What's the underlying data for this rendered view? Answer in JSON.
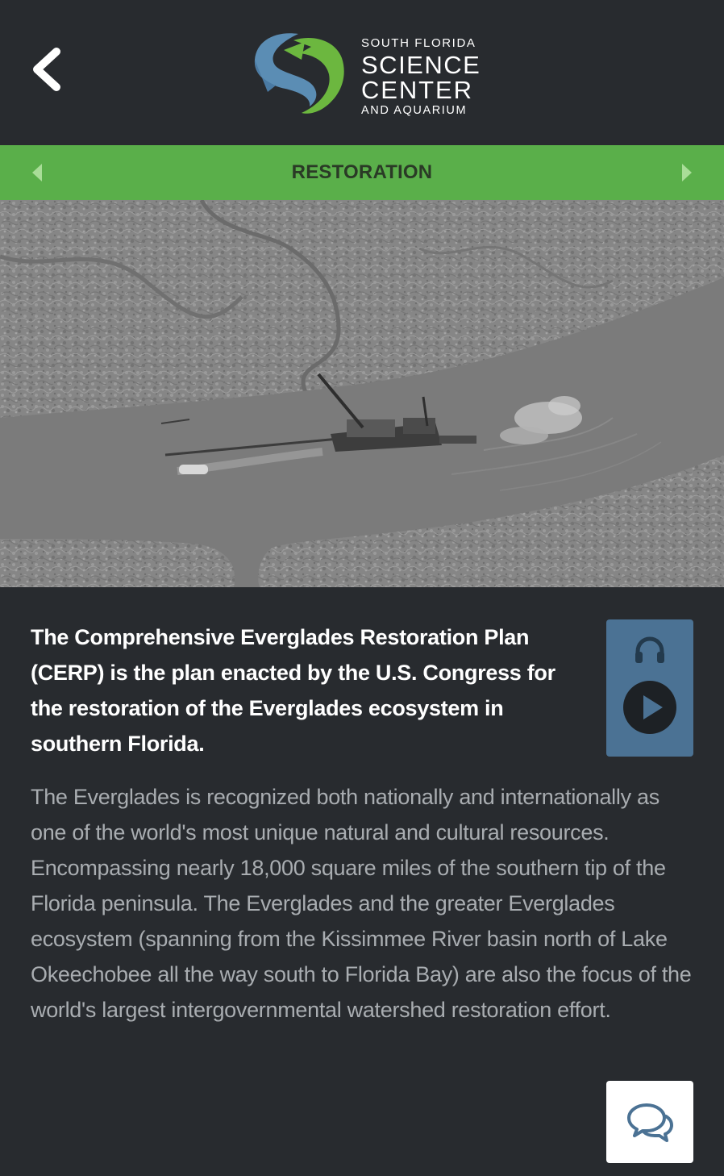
{
  "header": {
    "back_label": "Back",
    "logo": {
      "line1": "SOUTH FLORIDA",
      "line2": "SCIENCE",
      "line3": "CENTER",
      "line4": "AND AQUARIUM"
    }
  },
  "section_nav": {
    "title": "RESTORATION",
    "prev_icon": "triangle-left-icon",
    "next_icon": "triangle-right-icon"
  },
  "hero": {
    "image_subject": "aerial photo of dredging barge in Everglades channel"
  },
  "content": {
    "lead": "The Comprehensive Everglades Restoration Plan (CERP) is the plan enacted by the U.S. Congress for the restoration of the Everglades ecosystem in southern Florida.",
    "body": "The Everglades is recognized both nationally and internationally as one of the world's most unique natural and cultural resources. Encompassing nearly 18,000 square miles of the southern tip of the Florida peninsula. The Everglades and the greater Everglades ecosystem (spanning from the Kissimmee River basin north of Lake Okeechobee all the way south to Florida Bay) are also the focus of the world's largest intergovernmental watershed restoration effort."
  },
  "audio": {
    "icons": [
      "headphones-icon",
      "play-icon"
    ]
  },
  "chat": {
    "icon": "chat-bubbles-icon"
  },
  "colors": {
    "background": "#282b2f",
    "accent_green": "#5aaf4a",
    "audio_card": "#4b7294",
    "body_text": "#a9adb1",
    "logo_blue": "#5b8db4",
    "logo_green": "#6cb73f"
  }
}
